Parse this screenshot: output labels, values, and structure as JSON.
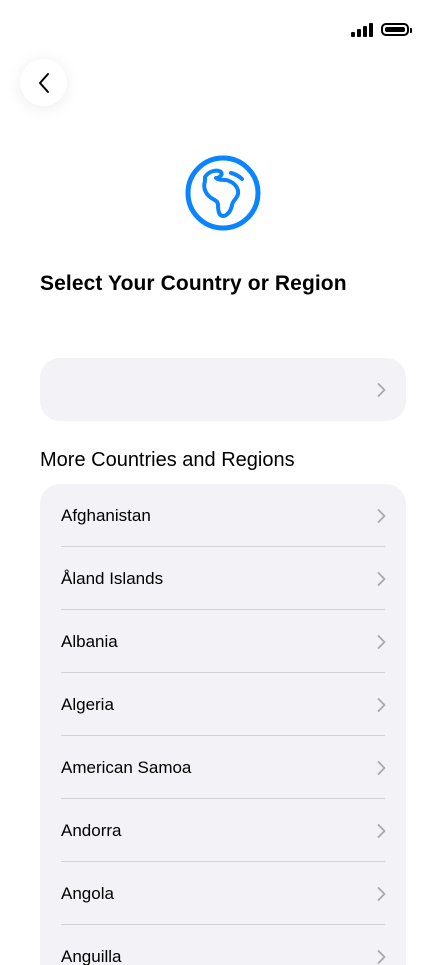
{
  "header": {
    "title": "Select Your Country or Region"
  },
  "current_selection": {
    "label": ""
  },
  "section": {
    "title": "More Countries and Regions"
  },
  "countries": [
    {
      "label": "Afghanistan"
    },
    {
      "label": "Åland Islands"
    },
    {
      "label": "Albania"
    },
    {
      "label": "Algeria"
    },
    {
      "label": "American Samoa"
    },
    {
      "label": "Andorra"
    },
    {
      "label": "Angola"
    },
    {
      "label": "Anguilla"
    }
  ],
  "colors": {
    "accent": "#0a84ff",
    "list_background": "#f2f2f7",
    "chevron": "#a8a8ad",
    "divider": "#d1d1d6"
  },
  "icons": {
    "back": "chevron-left-icon",
    "globe": "globe-africa-icon",
    "row": "chevron-right-icon"
  }
}
